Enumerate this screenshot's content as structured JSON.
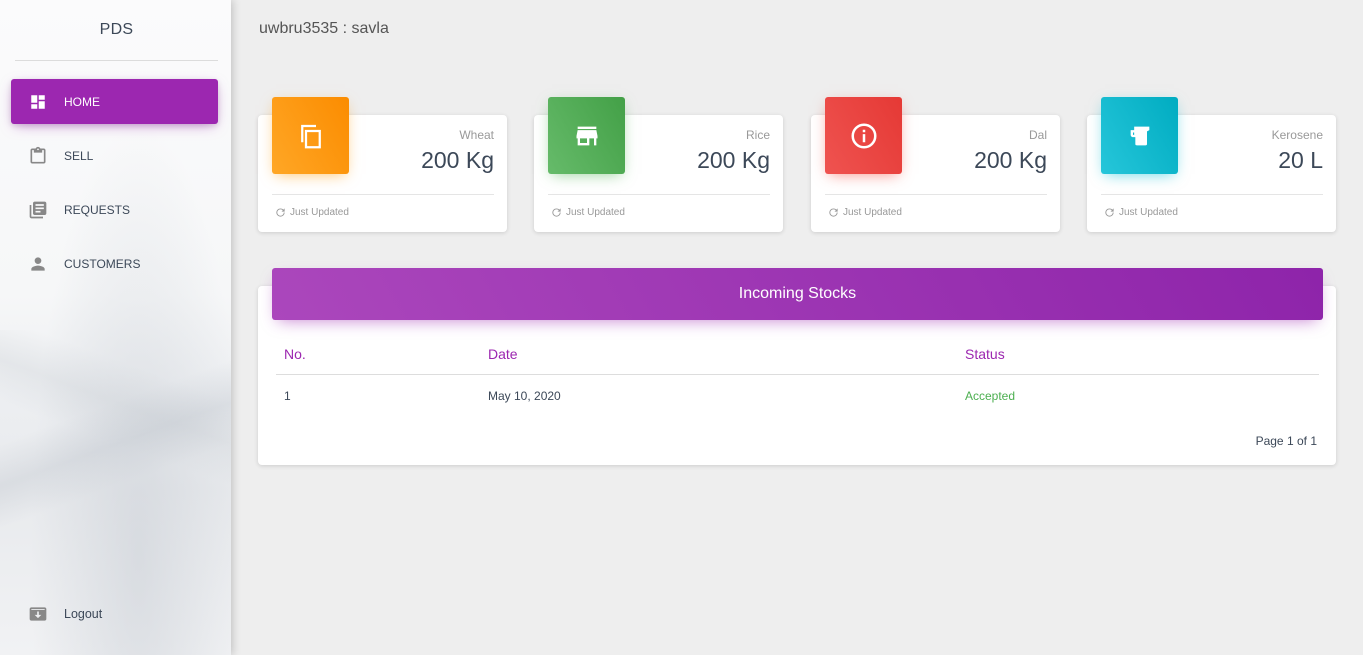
{
  "brand": "PDS",
  "header": {
    "user": "uwbru3535 : savla"
  },
  "nav": [
    {
      "label": "HOME",
      "icon": "dashboard-icon",
      "active": true
    },
    {
      "label": "SELL",
      "icon": "clipboard-icon",
      "active": false
    },
    {
      "label": "REQUESTS",
      "icon": "library-books-icon",
      "active": false
    },
    {
      "label": "CUSTOMERS",
      "icon": "person-icon",
      "active": false
    }
  ],
  "logout": {
    "label": "Logout",
    "icon": "archive-icon"
  },
  "cards": [
    {
      "title": "Wheat",
      "value": "200 Kg",
      "footer": "Just Updated",
      "icon": "copy-icon",
      "color": "#fb8c00"
    },
    {
      "title": "Rice",
      "value": "200 Kg",
      "footer": "Just Updated",
      "icon": "store-icon",
      "color": "#43a047"
    },
    {
      "title": "Dal",
      "value": "200 Kg",
      "footer": "Just Updated",
      "icon": "info-icon",
      "color": "#e53935"
    },
    {
      "title": "Kerosene",
      "value": "20 L",
      "footer": "Just Updated",
      "icon": "cup-icon",
      "color": "#00acc1"
    }
  ],
  "table": {
    "title": "Incoming Stocks",
    "columns": [
      "No.",
      "Date",
      "Status"
    ],
    "rows": [
      {
        "no": "1",
        "date": "May 10, 2020",
        "status": "Accepted"
      }
    ],
    "pager": {
      "prefix": "Page ",
      "current": "1",
      "of": " of ",
      "total": "1"
    }
  },
  "colors": {
    "accent": "#9c27b0",
    "success": "#4caf50"
  }
}
